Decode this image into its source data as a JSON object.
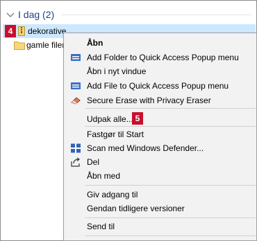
{
  "group": {
    "label": "I dag (2)"
  },
  "files": [
    {
      "name": "dekorative",
      "type": "zip-folder-icon",
      "selected": true
    },
    {
      "name": "gamle filer",
      "type": "folder-icon",
      "selected": false
    }
  ],
  "badges": {
    "first": "4",
    "second": "5"
  },
  "menu": {
    "items": [
      {
        "label": "Åbn",
        "bold": true,
        "icon": ""
      },
      {
        "label": "Add Folder to Quick Access Popup menu",
        "icon": "quick-access-icon"
      },
      {
        "label": "Åbn i nyt vindue",
        "icon": ""
      },
      {
        "label": "Add File to Quick Access Popup menu",
        "icon": "quick-access-icon"
      },
      {
        "label": "Secure Erase with Privacy Eraser",
        "icon": "eraser-icon"
      },
      {
        "label": "Udpak alle...",
        "icon": ""
      },
      {
        "label": "Fastgør til Start",
        "icon": ""
      },
      {
        "label": "Scan med Windows Defender...",
        "icon": "windows-defender-icon"
      },
      {
        "label": "Del",
        "icon": "share-icon"
      },
      {
        "label": "Åbn med",
        "icon": ""
      },
      {
        "label": "Giv adgang til",
        "icon": ""
      },
      {
        "label": "Gendan tidligere versioner",
        "icon": ""
      },
      {
        "label": "Send til",
        "icon": ""
      }
    ]
  },
  "colors": {
    "accent": "#1f3f8f",
    "selection": "#cce8ff",
    "badge": "#c8102e"
  }
}
